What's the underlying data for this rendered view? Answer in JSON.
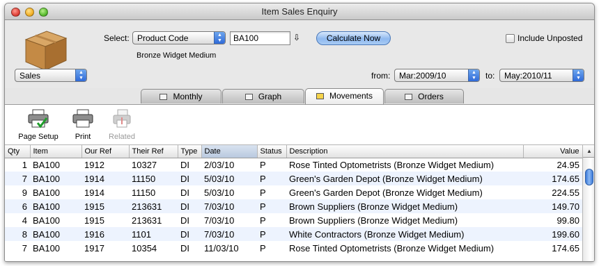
{
  "window": {
    "title": "Item Sales Enquiry"
  },
  "header": {
    "select_label": "Select:",
    "select_value": "Product Code",
    "code_value": "BA100",
    "item_description": "Bronze Widget Medium",
    "calculate_label": "Calculate Now",
    "include_unposted_label": "Include Unposted",
    "include_unposted_checked": false,
    "mode_value": "Sales",
    "from_label": "from:",
    "from_value": "Mar:2009/10",
    "to_label": "to:",
    "to_value": "May:2010/11"
  },
  "tabs": [
    {
      "label": "Monthly",
      "active": false
    },
    {
      "label": "Graph",
      "active": false
    },
    {
      "label": "Movements",
      "active": true
    },
    {
      "label": "Orders",
      "active": false
    }
  ],
  "toolbar": {
    "page_setup_label": "Page Setup",
    "print_label": "Print",
    "related_label": "Related"
  },
  "table": {
    "columns": [
      "Qty",
      "Item",
      "Our Ref",
      "Their Ref",
      "Type",
      "Date",
      "Status",
      "Description",
      "Value"
    ],
    "sorted_column": "Date",
    "rows": [
      [
        "1",
        "BA100",
        "1912",
        "10327",
        "DI",
        "2/03/10",
        "P",
        "Rose Tinted Optometrists (Bronze Widget Medium)",
        "24.95"
      ],
      [
        "7",
        "BA100",
        "1914",
        "11150",
        "DI",
        "5/03/10",
        "P",
        "Green's Garden Depot (Bronze Widget Medium)",
        "174.65"
      ],
      [
        "9",
        "BA100",
        "1914",
        "11150",
        "DI",
        "5/03/10",
        "P",
        "Green's Garden Depot (Bronze Widget Medium)",
        "224.55"
      ],
      [
        "6",
        "BA100",
        "1915",
        "213631",
        "DI",
        "7/03/10",
        "P",
        "Brown Suppliers (Bronze Widget Medium)",
        "149.70"
      ],
      [
        "4",
        "BA100",
        "1915",
        "213631",
        "DI",
        "7/03/10",
        "P",
        "Brown Suppliers (Bronze Widget Medium)",
        "99.80"
      ],
      [
        "8",
        "BA100",
        "1916",
        "1101",
        "DI",
        "7/03/10",
        "P",
        "White Contractors (Bronze Widget Medium)",
        "199.60"
      ],
      [
        "7",
        "BA100",
        "1917",
        "10354",
        "DI",
        "11/03/10",
        "P",
        "Rose Tinted Optometrists (Bronze Widget Medium)",
        "174.65"
      ]
    ]
  },
  "colors": {
    "accent": "#3b79d9",
    "row_alt": "#edf3fe",
    "window_bg": "#e6e6e6"
  },
  "icons": {
    "product": "cardboard-box-icon",
    "page_setup": "printer-check-icon",
    "print": "printer-icon",
    "related": "related-document-icon",
    "code_lookup": "arrow-down-icon"
  }
}
